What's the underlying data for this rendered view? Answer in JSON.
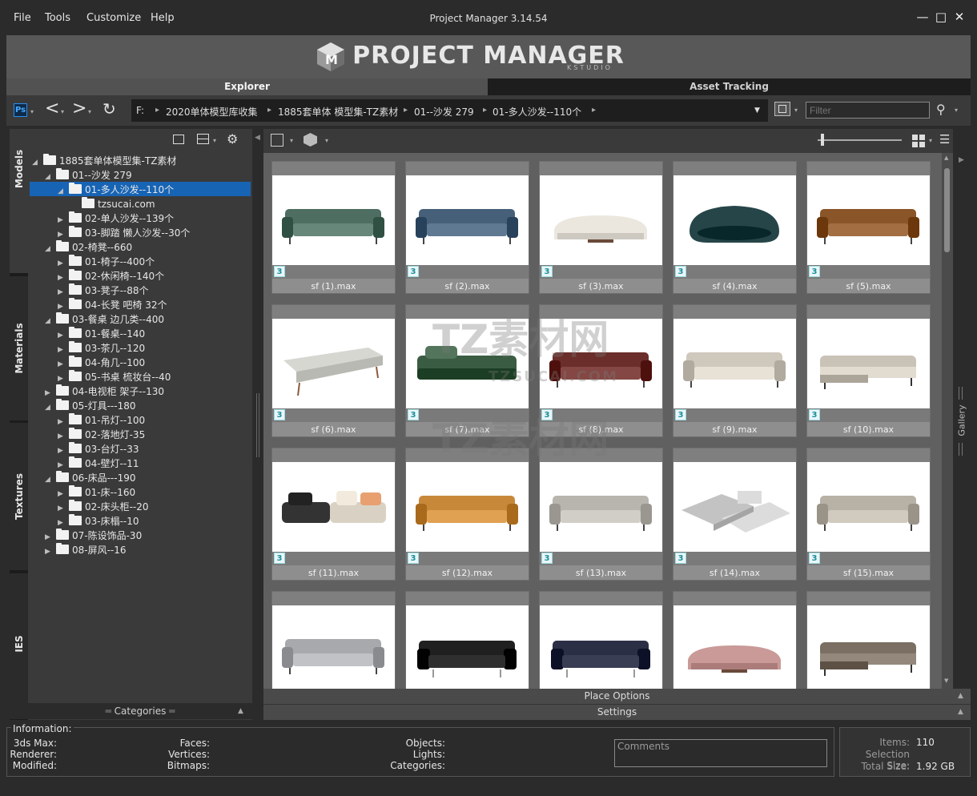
{
  "menu": [
    "File",
    "Tools",
    "Customize",
    "Help"
  ],
  "window_title": "Project Manager 3.14.54",
  "window_controls": [
    "minimize-icon",
    "maximize-icon",
    "close-icon"
  ],
  "logo": {
    "title": "PROJECT MANAGER",
    "sub": "KSTUDIO"
  },
  "tabs": {
    "explorer": "Explorer",
    "asset_tracking": "Asset Tracking"
  },
  "toolbar": {
    "ps_label": "Ps",
    "breadcrumb": [
      "F:",
      "2020单体模型库收集",
      "1885套单体 模型集-TZ素材",
      "01--沙发 279",
      "01-多人沙发--110个"
    ],
    "filter_placeholder": "Filter"
  },
  "side_tabs": [
    "Models",
    "Materials",
    "Textures",
    "IES"
  ],
  "tree": [
    {
      "label": "1885套单体模型集-TZ素材",
      "level": 0,
      "expanded": true
    },
    {
      "label": "01--沙发 279",
      "level": 1,
      "expanded": true
    },
    {
      "label": "01-多人沙发--110个",
      "level": 2,
      "expanded": true,
      "selected": true
    },
    {
      "label": "tzsucai.com",
      "level": 3,
      "expanded": false,
      "leaf": true
    },
    {
      "label": "02-单人沙发--139个",
      "level": 2,
      "expanded": false
    },
    {
      "label": "03-脚踏 懒人沙发--30个",
      "level": 2,
      "expanded": false
    },
    {
      "label": "02-椅凳--660",
      "level": 1,
      "expanded": true
    },
    {
      "label": "01-椅子--400个",
      "level": 2,
      "expanded": false
    },
    {
      "label": "02-休闲椅--140个",
      "level": 2,
      "expanded": false
    },
    {
      "label": "03-凳子--88个",
      "level": 2,
      "expanded": false
    },
    {
      "label": "04-长凳 吧椅 32个",
      "level": 2,
      "expanded": false
    },
    {
      "label": "03-餐桌 边几类--400",
      "level": 1,
      "expanded": true
    },
    {
      "label": "01-餐桌--140",
      "level": 2,
      "expanded": false
    },
    {
      "label": "03-茶几--120",
      "level": 2,
      "expanded": false
    },
    {
      "label": "04-角几--100",
      "level": 2,
      "expanded": false
    },
    {
      "label": "05-书桌 梳妆台--40",
      "level": 2,
      "expanded": false
    },
    {
      "label": "04-电视柜 架子--130",
      "level": 1,
      "expanded": false
    },
    {
      "label": "05-灯具---180",
      "level": 1,
      "expanded": true
    },
    {
      "label": "01-吊灯--100",
      "level": 2,
      "expanded": false
    },
    {
      "label": "02-落地灯-35",
      "level": 2,
      "expanded": false
    },
    {
      "label": "03-台灯--33",
      "level": 2,
      "expanded": false
    },
    {
      "label": "04-壁灯--11",
      "level": 2,
      "expanded": false
    },
    {
      "label": "06-床品---190",
      "level": 1,
      "expanded": true
    },
    {
      "label": "01-床--160",
      "level": 2,
      "expanded": false
    },
    {
      "label": "02-床头柜--20",
      "level": 2,
      "expanded": false
    },
    {
      "label": "03-床榻--10",
      "level": 2,
      "expanded": false
    },
    {
      "label": "07-陈设饰品-30",
      "level": 1,
      "expanded": false
    },
    {
      "label": "08-屏风--16",
      "level": 1,
      "expanded": false
    }
  ],
  "categories_footer": "Categories",
  "gallery": {
    "badge": "3",
    "items": [
      {
        "name": "sf (1).max",
        "color": "#4d6e60",
        "shape": "sectional"
      },
      {
        "name": "sf (2).max",
        "color": "#46607a",
        "shape": "channel"
      },
      {
        "name": "sf (3).max",
        "color": "#ebe7df",
        "shape": "curved"
      },
      {
        "name": "sf (4).max",
        "color": "#264548",
        "shape": "round"
      },
      {
        "name": "sf (5).max",
        "color": "#8a5528",
        "shape": "chesterfield"
      },
      {
        "name": "sf (6).max",
        "color": "#d7d7d2",
        "shape": "bench"
      },
      {
        "name": "sf (7).max",
        "color": "#3a5c42",
        "shape": "modular"
      },
      {
        "name": "sf (8).max",
        "color": "#6b2e2a",
        "shape": "low"
      },
      {
        "name": "sf (9).max",
        "color": "#cfc8bd",
        "shape": "classic"
      },
      {
        "name": "sf (10).max",
        "color": "#c9c2b7",
        "shape": "chaise"
      },
      {
        "name": "sf (11).max",
        "color": "#d9d2c4",
        "shape": "cushions"
      },
      {
        "name": "sf (12).max",
        "color": "#c8883a",
        "shape": "low"
      },
      {
        "name": "sf (13).max",
        "color": "#b8b5ae",
        "shape": "classic"
      },
      {
        "name": "sf (14).max",
        "color": "#c3c3c3",
        "shape": "islands"
      },
      {
        "name": "sf (15).max",
        "color": "#b7b1a6",
        "shape": "frame"
      },
      {
        "name": "",
        "color": "#a7a9ad",
        "shape": "classic"
      },
      {
        "name": "",
        "color": "#202020",
        "shape": "leather"
      },
      {
        "name": "",
        "color": "#2b2f45",
        "shape": "leather"
      },
      {
        "name": "",
        "color": "#c99a98",
        "shape": "curved"
      },
      {
        "name": "",
        "color": "#7a6f62",
        "shape": "chaise"
      }
    ]
  },
  "watermark": {
    "text": "TZ素材网",
    "sub": "TZSUCAI.COM"
  },
  "right_tab": "Gallery",
  "place_options": "Place Options",
  "settings": "Settings",
  "info": {
    "legend": "Information:",
    "labels_left": [
      "3ds Max:",
      "Renderer:",
      "Modified:"
    ],
    "labels_mid": [
      "Faces:",
      "Vertices:",
      "Bitmaps:"
    ],
    "labels_right": [
      "Objects:",
      "Lights:",
      "Categories:"
    ],
    "comments_placeholder": "Comments"
  },
  "stats": {
    "items_label": "Items:",
    "items_value": "110",
    "selection_label": "Selection Size:",
    "selection_value": "",
    "total_label": "Total Size:",
    "total_value": "1.92 GB"
  }
}
